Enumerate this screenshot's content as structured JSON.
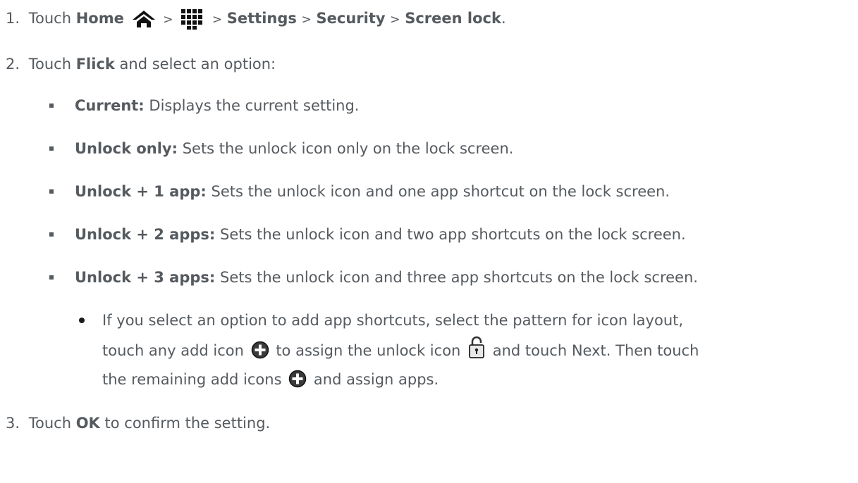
{
  "steps": [
    {
      "number": "1.",
      "touch": "Touch",
      "home": "Home",
      "sep": ">",
      "settings": "Settings",
      "security": "Security",
      "screen_lock": "Screen lock",
      "period": "."
    },
    {
      "number": "2.",
      "touch": "Touch",
      "flick": "Flick",
      "rest": "and select an option:"
    },
    {
      "number": "3.",
      "touch": "Touch",
      "ok": "OK",
      "rest": "to confirm the setting."
    }
  ],
  "options": [
    {
      "label": "Current:",
      "desc": "Displays the current setting."
    },
    {
      "label": "Unlock only:",
      "desc": "Sets the unlock icon only on the lock screen."
    },
    {
      "label": "Unlock + 1 app:",
      "desc": "Sets the unlock icon and one app shortcut on the lock screen."
    },
    {
      "label": "Unlock + 2 apps:",
      "desc": "Sets the unlock icon and two app shortcuts on the lock screen."
    },
    {
      "label": "Unlock + 3 apps:",
      "desc": "Sets the unlock icon and three app shortcuts on the lock screen."
    }
  ],
  "note": {
    "line1": "If you select an option to add app shortcuts, select the pattern for icon layout,",
    "line2a": "touch any add icon",
    "line2b": "to assign the unlock icon",
    "line2c": "and touch Next. Then touch",
    "line3a": "the remaining add icons",
    "line3b": "and assign apps."
  },
  "icons": {
    "home": "home-icon",
    "apps": "app-grid-icon",
    "add": "add-circle-icon",
    "unlock": "unlock-icon"
  }
}
